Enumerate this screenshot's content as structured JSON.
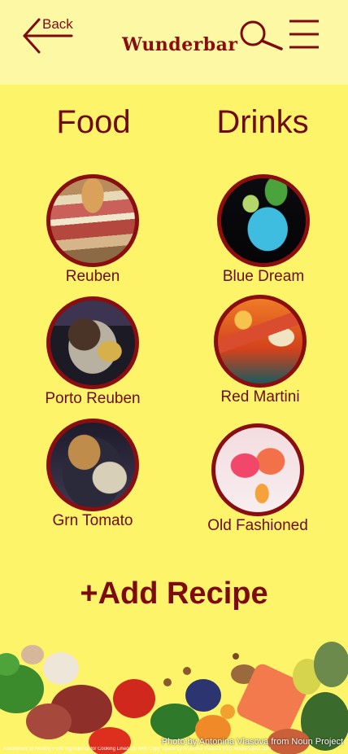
{
  "header": {
    "back_label": "Back",
    "brand": "Wunderbar",
    "icons": {
      "back": "arrow-left-icon",
      "search": "search-icon",
      "menu": "hamburger-menu-icon"
    }
  },
  "categories": {
    "food": "Food",
    "drinks": "Drinks"
  },
  "food_items": [
    {
      "label": "Reuben"
    },
    {
      "label": "Porto Reuben"
    },
    {
      "label": "Grn Tomato"
    }
  ],
  "drink_items": [
    {
      "label": "Blue Dream"
    },
    {
      "label": "Red Martini"
    },
    {
      "label": "Old Fashioned"
    }
  ],
  "add_recipe_label": "+Add Recipe",
  "credits": {
    "main": "Photo by Antonina Vlasova from Noun Project",
    "small": "Assortment of Healthy Food Ingredients for Cooking Lined Up With Copy Space by Antonina Vlasova from NounProject.com"
  },
  "colors": {
    "background": "#fdf46a",
    "header": "#fdf8a3",
    "accent": "#7d0b0d"
  }
}
